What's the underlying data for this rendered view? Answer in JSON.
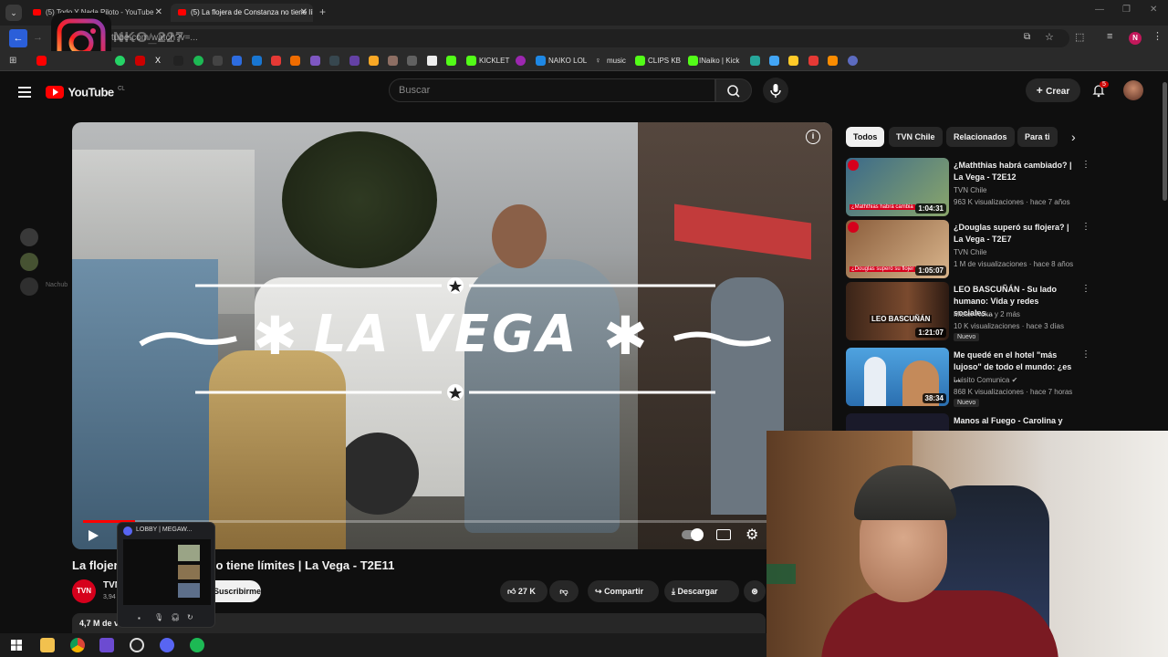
{
  "browser": {
    "tabs": [
      {
        "title": "(5) Todo Y Nada Piloto - YouTube"
      },
      {
        "title": "(5) La flojera de Constanza no tiene límites"
      }
    ],
    "address": "tube.com/watch?v=...",
    "overlay_handle": "NKO_227",
    "bookmarks": [
      {
        "label": "KICKLET"
      },
      {
        "label": "NAIKO LOL"
      },
      {
        "label": "music"
      },
      {
        "label": "CLIPS KB"
      },
      {
        "label": "INaiko | Kick"
      }
    ],
    "profile_initial": "N"
  },
  "youtube": {
    "logo_text": "YouTube",
    "logo_region": "CL",
    "search_placeholder": "Buscar",
    "create_label": "Crear",
    "notifications_count": "5"
  },
  "video": {
    "overlay_title": "LA VEGA",
    "title": "La flojera de Constanza no tiene límites | La Vega - T2E11",
    "channel_abbr": "TVN",
    "channel_name": "TVN",
    "subscribers": "3,94",
    "subscribe_label": "Suscribirme",
    "likes": "27 K",
    "share_label": "Compartir",
    "download_label": "Descargar",
    "views_line": "4,7 M de visualizaciones",
    "progress_fraction": 0.07
  },
  "chips": [
    "Todos",
    "TVN Chile",
    "Relacionados",
    "Para ti"
  ],
  "recommendations": [
    {
      "title": "¿Maththias habrá cambiado? | La Vega - T2E12",
      "channel": "TVN Chile",
      "meta": "963 K visualizaciones · hace 7 años",
      "duration": "1:04:31",
      "thumb_caption": "¿Maththias habrá cambia",
      "badge": ""
    },
    {
      "title": "¿Douglas superó su flojera? | La Vega - T2E7",
      "channel": "TVN Chile",
      "meta": "1 M de visualizaciones · hace 8 años",
      "duration": "1:05:07",
      "thumb_caption": "¿Douglas superó su flojer",
      "badge": ""
    },
    {
      "title": "LEO BASCUÑÁN - Su lado humano: Vida y redes sociales...",
      "channel": "Mister Roka y 2 más",
      "meta": "10 K visualizaciones · hace 3 días",
      "duration": "1:21:07",
      "thumb_caption": "LEO BASCUÑÁN",
      "badge": "Nuevo"
    },
    {
      "title": "Me quedé en el hotel \"más lujoso\" de todo el mundo: ¿es ...",
      "channel": "Luisito Comunica",
      "meta": "868 K visualizaciones · hace 7 horas",
      "duration": "38:34",
      "thumb_caption": "",
      "badge": "Nuevo"
    },
    {
      "title": "Manos al Fuego - Carolina y",
      "channel": "",
      "meta": "",
      "duration": "",
      "thumb_caption": "",
      "badge": ""
    }
  ],
  "discord_popup": {
    "title": "LOBBY | MEGAW..."
  },
  "discord_side": {
    "label": "Nachub"
  },
  "colors": {
    "youtube_red": "#ff0000",
    "bg": "#0f0f0f",
    "chip_bg": "#272727"
  }
}
